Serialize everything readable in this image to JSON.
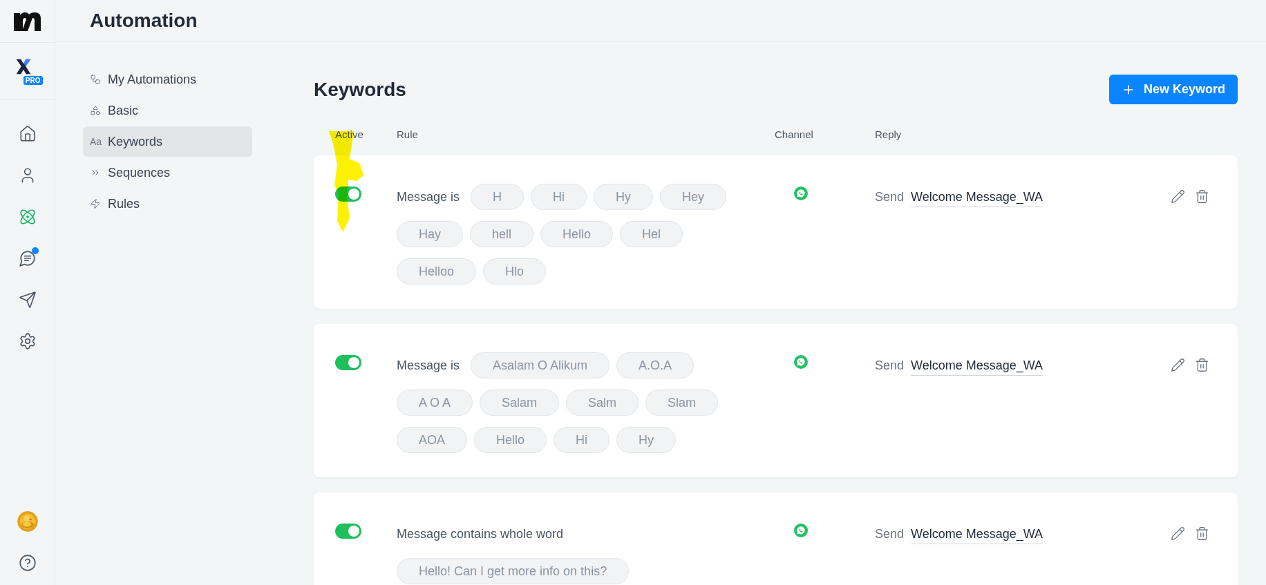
{
  "brand": {
    "badge": "PRO"
  },
  "header": {
    "title": "Automation"
  },
  "rail": [
    {
      "kind": "home",
      "selected": false,
      "badge": false
    },
    {
      "kind": "user",
      "selected": false,
      "badge": false
    },
    {
      "kind": "atom",
      "selected": true,
      "badge": false
    },
    {
      "kind": "chat",
      "selected": false,
      "badge": true
    },
    {
      "kind": "send",
      "selected": false,
      "badge": false
    },
    {
      "kind": "settings",
      "selected": false,
      "badge": false
    }
  ],
  "rail_bottom": [
    {
      "kind": "picture"
    },
    {
      "kind": "help"
    }
  ],
  "submenu": [
    {
      "kind": "workflow",
      "label": "My Automations",
      "selected": false
    },
    {
      "kind": "shapes",
      "label": "Basic",
      "selected": false
    },
    {
      "kind": "text",
      "icon_text": "Aa",
      "label": "Keywords",
      "selected": true
    },
    {
      "kind": "chevrons",
      "label": "Sequences",
      "selected": false
    },
    {
      "kind": "zap",
      "label": "Rules",
      "selected": false
    }
  ],
  "page": {
    "title": "Keywords",
    "button": "New Keyword"
  },
  "columns": [
    "Active",
    "Rule",
    "Channel",
    "Reply"
  ],
  "rows": [
    {
      "active": true,
      "rule": "Message is",
      "keywords": [
        "H",
        "Hi",
        "Hy",
        "Hey",
        "Hay",
        "hell",
        "Hello",
        "Hel",
        "Helloo",
        "Hlo"
      ],
      "reply_prefix": "Send",
      "reply": "Welcome Message_WA"
    },
    {
      "active": true,
      "rule": "Message is",
      "keywords": [
        "Asalam O Alikum",
        "A.O.A",
        "A O A",
        "Salam",
        "Salm",
        "Slam",
        "AOA",
        "Hello",
        "Hi",
        "Hy"
      ],
      "reply_prefix": "Send",
      "reply": "Welcome Message_WA"
    },
    {
      "active": true,
      "rule": "Message contains whole word",
      "keywords": [
        "Hello! Can I get more info on this?"
      ],
      "reply_prefix": "Send",
      "reply": "Welcome Message_WA"
    }
  ]
}
